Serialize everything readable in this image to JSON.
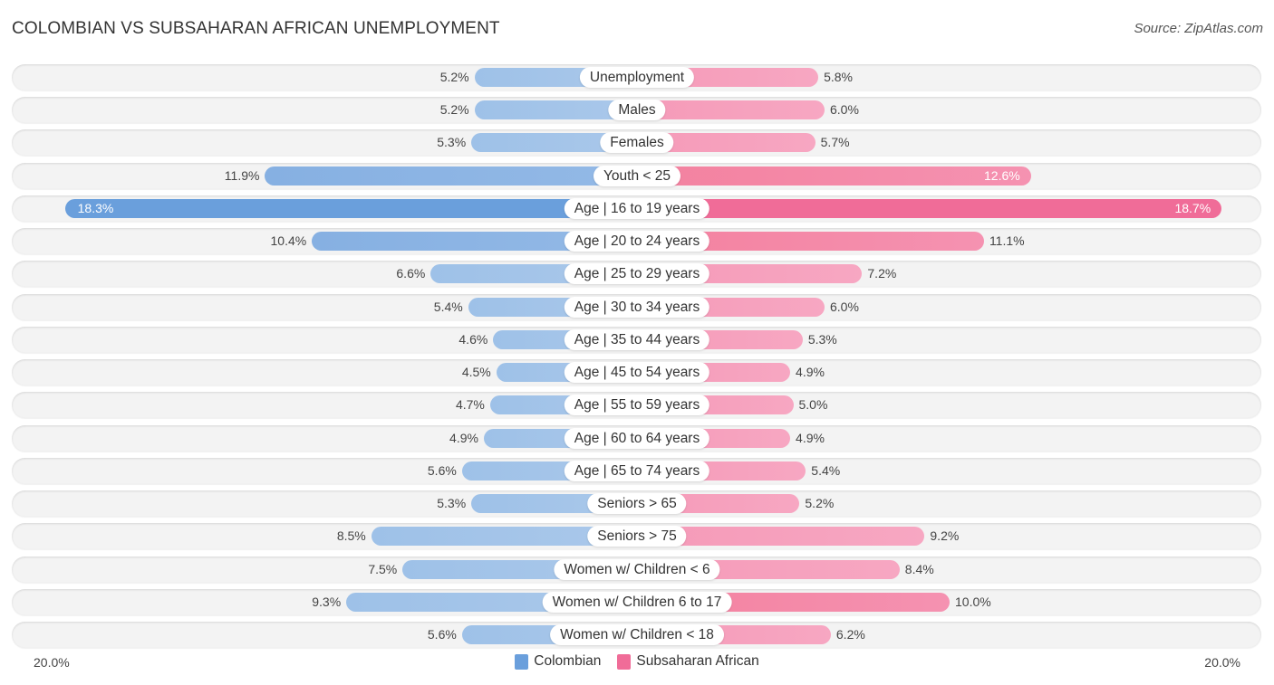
{
  "title": "COLOMBIAN VS SUBSAHARAN AFRICAN UNEMPLOYMENT",
  "source": "Source: ZipAtlas.com",
  "colors": {
    "colombian": "#6a9fdc",
    "subsaharan_african": "#f06c98"
  },
  "chart_data": {
    "type": "bar",
    "orientation": "horizontal-diverging",
    "title": "COLOMBIAN VS SUBSAHARAN AFRICAN UNEMPLOYMENT",
    "xlabel": "",
    "ylabel": "",
    "xlim": [
      -20,
      20
    ],
    "axis_labels": {
      "left": "20.0%",
      "right": "20.0%"
    },
    "legend_position": "bottom-center",
    "categories": [
      "Unemployment",
      "Males",
      "Females",
      "Youth < 25",
      "Age | 16 to 19 years",
      "Age | 20 to 24 years",
      "Age | 25 to 29 years",
      "Age | 30 to 34 years",
      "Age | 35 to 44 years",
      "Age | 45 to 54 years",
      "Age | 55 to 59 years",
      "Age | 60 to 64 years",
      "Age | 65 to 74 years",
      "Seniors > 65",
      "Seniors > 75",
      "Women w/ Children < 6",
      "Women w/ Children 6 to 17",
      "Women w/ Children < 18"
    ],
    "series": [
      {
        "name": "Colombian",
        "side": "left",
        "values": [
          5.2,
          5.2,
          5.3,
          11.9,
          18.3,
          10.4,
          6.6,
          5.4,
          4.6,
          4.5,
          4.7,
          4.9,
          5.6,
          5.3,
          8.5,
          7.5,
          9.3,
          5.6
        ],
        "labels": [
          "5.2%",
          "5.2%",
          "5.3%",
          "11.9%",
          "18.3%",
          "10.4%",
          "6.6%",
          "5.4%",
          "4.6%",
          "4.5%",
          "4.7%",
          "4.9%",
          "5.6%",
          "5.3%",
          "8.5%",
          "7.5%",
          "9.3%",
          "5.6%"
        ]
      },
      {
        "name": "Subsaharan African",
        "side": "right",
        "values": [
          5.8,
          6.0,
          5.7,
          12.6,
          18.7,
          11.1,
          7.2,
          6.0,
          5.3,
          4.9,
          5.0,
          4.9,
          5.4,
          5.2,
          9.2,
          8.4,
          10.0,
          6.2
        ],
        "labels": [
          "5.8%",
          "6.0%",
          "5.7%",
          "12.6%",
          "18.7%",
          "11.1%",
          "7.2%",
          "6.0%",
          "5.3%",
          "4.9%",
          "5.0%",
          "4.9%",
          "5.4%",
          "5.2%",
          "9.2%",
          "8.4%",
          "10.0%",
          "6.2%"
        ]
      }
    ]
  },
  "legend": [
    {
      "label": "Colombian"
    },
    {
      "label": "Subsaharan African"
    }
  ]
}
